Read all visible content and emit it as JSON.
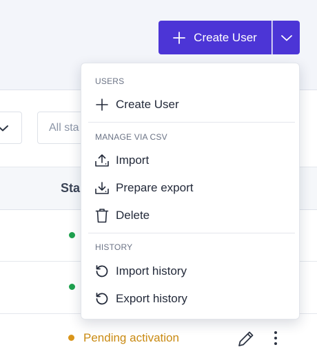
{
  "header": {
    "create_button_label": "Create User",
    "create_button_color": "#4c35d6"
  },
  "filters": {
    "status_filter_text": "All sta"
  },
  "table": {
    "status_column_label": "Sta",
    "rows": [
      {
        "status_color": "#1ea14e"
      },
      {
        "status_color": "#1ea14e"
      },
      {
        "status_label": "Pending activation",
        "status_color": "#d9951b"
      }
    ]
  },
  "menu": {
    "sections": [
      {
        "title": "USERS",
        "items": [
          {
            "label": "Create User",
            "icon": "plus-icon"
          }
        ]
      },
      {
        "title": "MANAGE VIA CSV",
        "items": [
          {
            "label": "Import",
            "icon": "upload-icon"
          },
          {
            "label": "Prepare export",
            "icon": "download-icon"
          },
          {
            "label": "Delete",
            "icon": "trash-icon"
          }
        ]
      },
      {
        "title": "HISTORY",
        "items": [
          {
            "label": "Import history",
            "icon": "history-icon"
          },
          {
            "label": "Export history",
            "icon": "history-icon"
          }
        ]
      }
    ]
  }
}
